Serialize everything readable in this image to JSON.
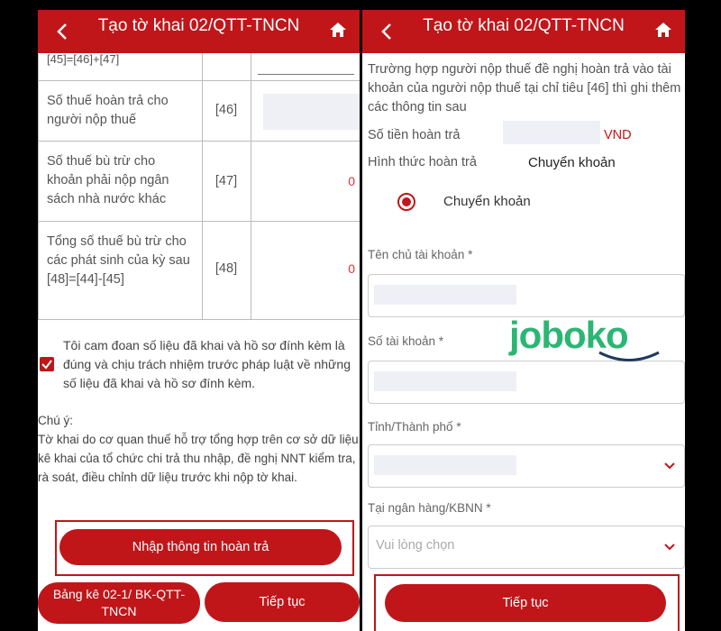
{
  "left": {
    "header": {
      "title": "Tạo tờ khai 02/QTT-TNCN"
    },
    "table": {
      "partial_formula": "[45]=[46]+[47]",
      "rows": [
        {
          "label": "Số thuế hoàn trả cho người nộp thuế",
          "code": "[46]",
          "value": ""
        },
        {
          "label": "Số thuế bù trừ cho khoản phải nộp ngân sách nhà nước khác",
          "code": "[47]",
          "value": "0"
        },
        {
          "label": "Tổng số thuế bù trừ cho các phát sinh của kỳ sau [48]=[44]-[45]",
          "code": "[48]",
          "value": "0"
        }
      ]
    },
    "commitment": "Tôi cam đoan số liệu đã khai và hồ sơ đính kèm là đúng và chịu trách nhiệm trước pháp luật về những số liệu đã khai và hồ sơ đính kèm.",
    "note_title": "Chú ý:",
    "note_text": "Tờ khai do cơ quan thuế hỗ trợ tổng hợp trên cơ sở dữ liệu kê khai của tổ chức chi trả thu nhập, đề nghị NNT kiểm tra, rà soát, điều chỉnh dữ liệu trước khi nộp tờ khai.",
    "refund_button": "Nhập thông tin hoàn trả",
    "bk_button": "Bảng kê 02-1/ BK-QTT-TNCN",
    "continue_button": "Tiếp tục"
  },
  "right": {
    "header": {
      "title": "Tạo tờ khai 02/QTT-TNCN"
    },
    "intro": "Trường hợp người nộp thuế đề nghị hoàn trả vào tài khoản của người nộp thuế tại chỉ tiêu [46] thì ghi thêm các thông tin sau",
    "refund_amount_label": "Số tiền hoàn trả",
    "currency": "VND",
    "method_label": "Hình thức hoàn trả",
    "method_value": "Chuyển khoản",
    "radio_label": "Chuyển khoản",
    "account_holder_label": "Tên chủ tài khoản *",
    "account_number_label": "Số tài khoản *",
    "province_label": "Tỉnh/Thành phố *",
    "bank_label": "Tại ngân hàng/KBNN *",
    "bank_placeholder": "Vui lòng chọn",
    "continue_button": "Tiếp tục"
  },
  "watermark": {
    "text": "joboko"
  },
  "colors": {
    "primary": "#c0161a",
    "watermark_green": "#2bb673",
    "watermark_navy": "#1f3a5f"
  }
}
